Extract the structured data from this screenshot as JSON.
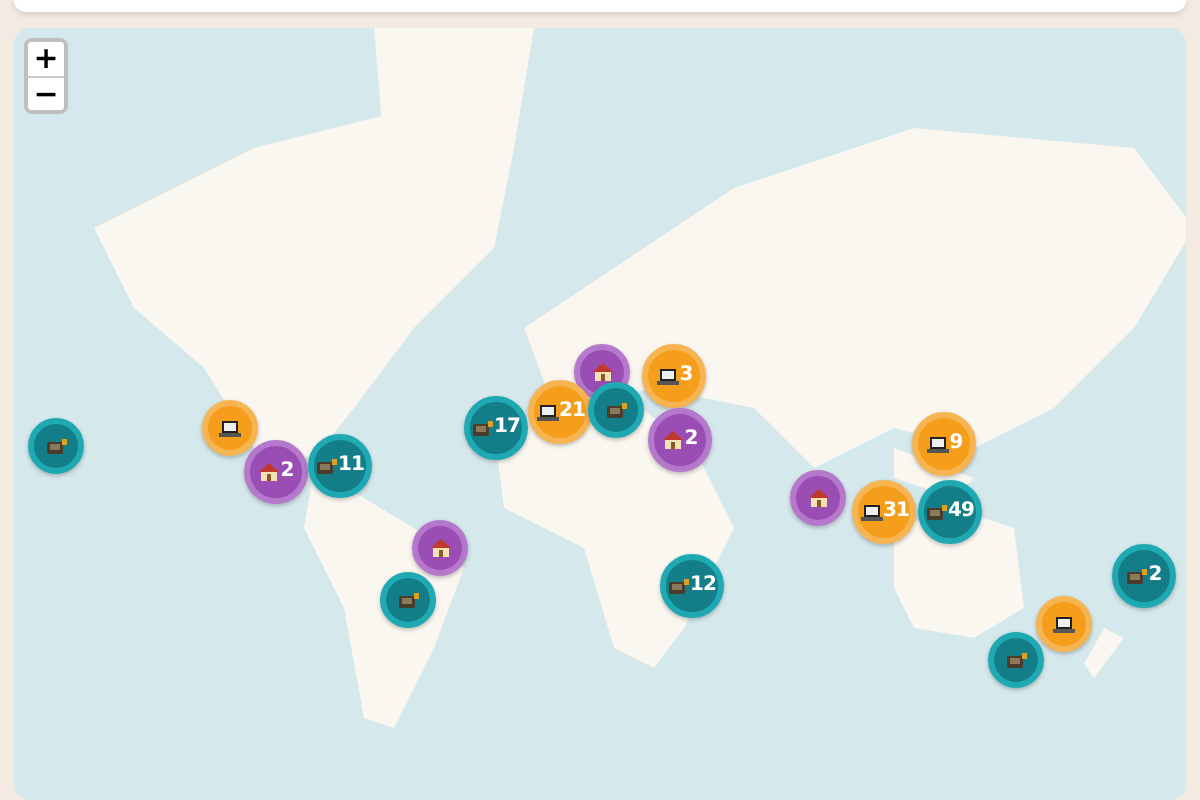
{
  "zoom_controls": [
    {
      "label": "+"
    },
    {
      "label": "−"
    }
  ],
  "markers": [
    {
      "kind": "camera"
    },
    {
      "kind": "laptop"
    },
    {
      "kind": "house",
      "count": "2"
    },
    {
      "kind": "camera",
      "count": "11"
    },
    {
      "kind": "house"
    },
    {
      "kind": "laptop",
      "count": "21"
    },
    {
      "kind": "camera",
      "count": "17"
    },
    {
      "kind": "camera"
    },
    {
      "kind": "laptop",
      "count": "3"
    },
    {
      "kind": "house",
      "count": "2"
    },
    {
      "kind": "house"
    },
    {
      "kind": "camera"
    },
    {
      "kind": "camera",
      "count": "12"
    },
    {
      "kind": "house"
    },
    {
      "kind": "laptop",
      "count": "9"
    },
    {
      "kind": "laptop",
      "count": "31"
    },
    {
      "kind": "camera",
      "count": "49"
    },
    {
      "kind": "camera",
      "count": "2"
    },
    {
      "kind": "laptop"
    },
    {
      "kind": "camera"
    }
  ]
}
